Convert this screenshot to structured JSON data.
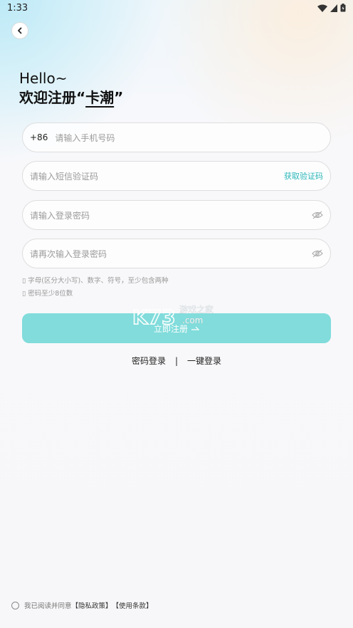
{
  "status_bar": {
    "time": "1:33",
    "icons": [
      "wifi-icon",
      "signal-icon",
      "battery-icon"
    ]
  },
  "header": {
    "back_icon": "chevron-left-icon"
  },
  "greeting": {
    "line1": "Hello~",
    "line2_prefix": "欢迎注册“",
    "brand": "卡潮",
    "line2_suffix": "”"
  },
  "form": {
    "phone": {
      "prefix": "+86",
      "placeholder": "请输入手机号码"
    },
    "sms_code": {
      "placeholder": "请输入短信验证码",
      "action": "获取验证码"
    },
    "password": {
      "placeholder": "请输入登录密码"
    },
    "password_confirm": {
      "placeholder": "请再次输入登录密码"
    },
    "hints": [
      "字母(区分大小写)、数字、符号，至少包含两种",
      "密码至少8位数"
    ],
    "submit": "立即注册"
  },
  "alt_login": {
    "password_login": "密码登录",
    "separator": "|",
    "quick_login": "一键登录"
  },
  "watermark": {
    "logo": "K73",
    "line1": "游戏之家",
    "line2": ".com"
  },
  "agreement": {
    "text": "我已阅读并同意",
    "privacy": "【隐私政策】",
    "terms": "【使用条款】"
  },
  "colors": {
    "accent": "#2ab7b9",
    "button": "#81dcdb",
    "border": "#dedede"
  }
}
